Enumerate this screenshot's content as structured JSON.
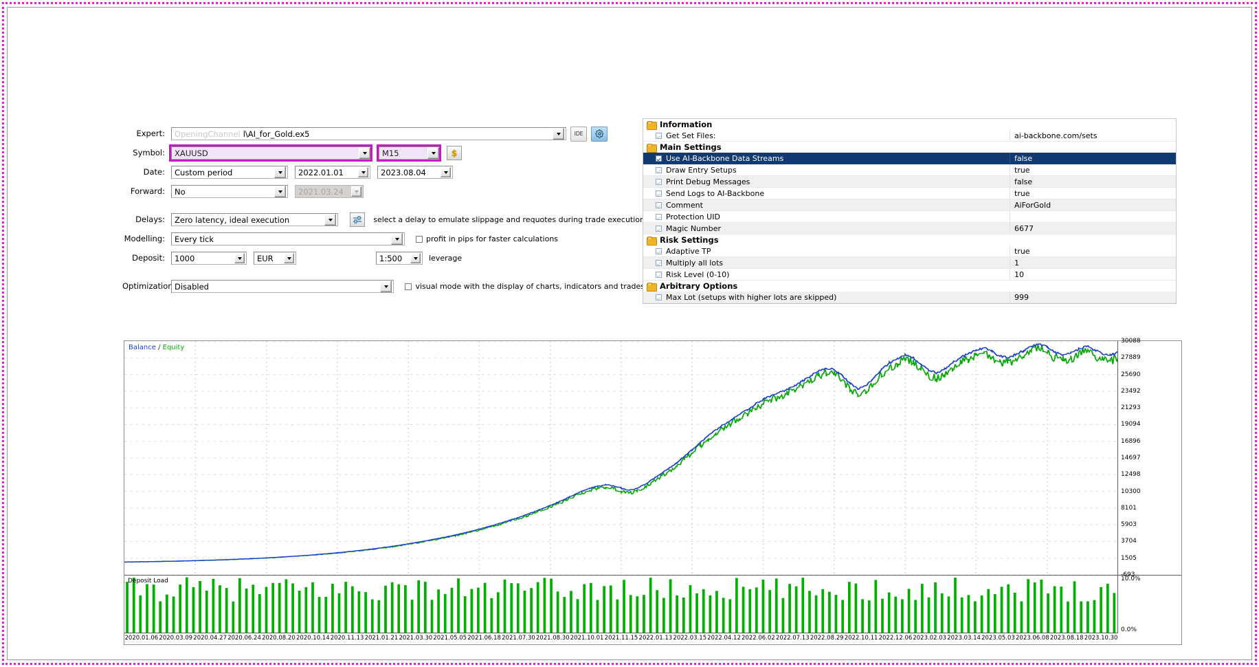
{
  "settings": {
    "expert": {
      "label": "Expert:",
      "ghost_text": "OpeningChannel",
      "value": "l\\AI_for_Gold.ex5",
      "ide_button": "IDE",
      "gear_icon": "gear-icon"
    },
    "symbol": {
      "label": "Symbol:",
      "value": "XAUUSD",
      "timeframe": "M15",
      "currency_button": "$"
    },
    "date": {
      "label": "Date:",
      "mode": "Custom period",
      "from": "2022.01.01",
      "to": "2023.08.04"
    },
    "forward": {
      "label": "Forward:",
      "mode": "No",
      "date": "2021.03.24"
    },
    "delays": {
      "label": "Delays:",
      "value": "Zero latency, ideal execution",
      "hint": "select a delay to emulate slippage and requotes during trade execution",
      "slider_icon": "slider-icon"
    },
    "modelling": {
      "label": "Modelling:",
      "value": "Every tick",
      "checkbox_label": "profit in pips for faster calculations",
      "checked": false
    },
    "deposit": {
      "label": "Deposit:",
      "value": "1000",
      "currency": "EUR",
      "leverage": "1:500",
      "leverage_label": "leverage"
    },
    "optimization": {
      "label": "Optimization:",
      "value": "Disabled",
      "checkbox_label": "visual mode with the display of charts, indicators and trades",
      "checked": false
    }
  },
  "params": {
    "groups": [
      {
        "title": "Information",
        "rows": [
          {
            "name": "Get Set Files:",
            "value": "ai-backbone.com/sets",
            "selected": false
          }
        ]
      },
      {
        "title": "Main Settings",
        "rows": [
          {
            "name": "Use AI-Backbone Data Streams",
            "value": "false",
            "selected": true
          },
          {
            "name": "Draw Entry Setups",
            "value": "true",
            "selected": false
          },
          {
            "name": "Print Debug Messages",
            "value": "false",
            "selected": false
          },
          {
            "name": "Send Logs to AI-Backbone",
            "value": "true",
            "selected": false
          },
          {
            "name": "Comment",
            "value": "AiForGold",
            "selected": false
          },
          {
            "name": "Protection UID",
            "value": "",
            "selected": false
          },
          {
            "name": "Magic Number",
            "value": "6677",
            "selected": false
          }
        ]
      },
      {
        "title": "Risk Settings",
        "rows": [
          {
            "name": "Adaptive TP",
            "value": "true",
            "selected": false
          },
          {
            "name": "Multiply all lots",
            "value": "1",
            "selected": false
          },
          {
            "name": "Risk Level (0-10)",
            "value": "10",
            "selected": false
          }
        ]
      },
      {
        "title": "Arbitrary Options",
        "rows": [
          {
            "name": "Max Lot (setups with higher lots are skipped)",
            "value": "999",
            "selected": false
          }
        ]
      }
    ]
  },
  "chart_data": {
    "type": "line",
    "title": "",
    "legend": {
      "balance": "Balance",
      "separator": "/",
      "equity": "Equity",
      "position": "top-left"
    },
    "colors": {
      "balance": "#1a3fd0",
      "equity": "#0aa80a",
      "deposit_load": "#00b000"
    },
    "xlabel": "",
    "ylabel": "",
    "ylim": [
      -693,
      30088
    ],
    "yticks": [
      "30088",
      "27889",
      "25690",
      "23492",
      "21293",
      "19094",
      "16896",
      "14697",
      "12498",
      "10300",
      "8101",
      "5903",
      "3704",
      "1505",
      "-693"
    ],
    "xticks": [
      "2020.01.06",
      "2020.03.09",
      "2020.04.27",
      "2020.06.24",
      "2020.08.20",
      "2020.10.14",
      "2020.11.13",
      "2021.01.21",
      "2021.03.30",
      "2021.05.05",
      "2021.06.18",
      "2021.07.30",
      "2021.08.30",
      "2021.10.01",
      "2021.11.15",
      "2022.01.13",
      "2022.03.15",
      "2022.04.12",
      "2022.06.02",
      "2022.07.13",
      "2022.08.29",
      "2022.10.11",
      "2022.12.06",
      "2023.02.03",
      "2023.03.14",
      "2023.05.03",
      "2023.06.08",
      "2023.08.18",
      "2023.10.30"
    ],
    "series": [
      {
        "name": "Balance",
        "color": "#1a3fd0",
        "values": [
          1000,
          1010,
          1030,
          1045,
          1060,
          1080,
          1100,
          1125,
          1150,
          1180,
          1210,
          1240,
          1275,
          1310,
          1350,
          1395,
          1440,
          1490,
          1545,
          1600,
          1660,
          1725,
          1795,
          1870,
          1950,
          2035,
          2125,
          2220,
          2320,
          2430,
          2545,
          2665,
          2790,
          2925,
          3070,
          3225,
          3390,
          3560,
          3740,
          3930,
          4130,
          4345,
          4570,
          4810,
          5060,
          5330,
          5610,
          5900,
          6210,
          6540,
          6880,
          7240,
          7620,
          8020,
          8440,
          8880,
          9340,
          9820,
          10300,
          10700,
          11000,
          11150,
          11050,
          10700,
          10450,
          10680,
          11200,
          11900,
          12600,
          13300,
          14050,
          14900,
          15800,
          16700,
          17600,
          18400,
          19100,
          19750,
          20400,
          21050,
          21750,
          22400,
          22900,
          23300,
          23700,
          24200,
          24800,
          25500,
          26100,
          26500,
          26300,
          25600,
          24500,
          23800,
          24200,
          25200,
          26300,
          27200,
          27800,
          28200,
          27900,
          27000,
          26200,
          25900,
          26400,
          27200,
          27900,
          28400,
          28900,
          29200,
          28700,
          28100,
          27900,
          28300,
          28800,
          29400,
          29700,
          29300,
          28600,
          28200,
          28500,
          29000,
          29400,
          28900,
          28400,
          28200,
          28600
        ]
      },
      {
        "name": "Equity",
        "color": "#0aa80a",
        "values": [
          1000,
          1005,
          1022,
          1038,
          1050,
          1072,
          1090,
          1112,
          1140,
          1168,
          1198,
          1228,
          1262,
          1296,
          1335,
          1378,
          1424,
          1472,
          1526,
          1580,
          1638,
          1702,
          1770,
          1842,
          1920,
          2002,
          2090,
          2182,
          2280,
          2386,
          2498,
          2616,
          2738,
          2870,
          3012,
          3162,
          3322,
          3488,
          3662,
          3848,
          4042,
          4250,
          4470,
          4702,
          4946,
          5208,
          5480,
          5762,
          6062,
          6382,
          6712,
          7062,
          7430,
          7818,
          8226,
          8652,
          9098,
          9562,
          10020,
          10400,
          10680,
          10800,
          10680,
          10300,
          10020,
          10280,
          10820,
          11540,
          12240,
          12920,
          13660,
          14500,
          15400,
          16280,
          17160,
          17940,
          18620,
          19260,
          19900,
          20520,
          21200,
          21840,
          22320,
          22700,
          23080,
          23580,
          24180,
          24880,
          25460,
          25840,
          25600,
          24880,
          23760,
          23080,
          23480,
          24500,
          25620,
          26520,
          27120,
          27500,
          27160,
          26240,
          25440,
          25140,
          25680,
          26480,
          27180,
          27680,
          28180,
          28480,
          27940,
          27340,
          27140,
          27560,
          28060,
          28680,
          28980,
          28560,
          27840,
          27440,
          27740,
          28260,
          28660,
          28140,
          27640,
          27440,
          27860
        ]
      }
    ],
    "deposit_load": {
      "label": "Deposit Load",
      "max_label": "10.0%",
      "min_label": "0.0%",
      "ylim": [
        0,
        10
      ],
      "bar_color": "#00b000"
    }
  }
}
